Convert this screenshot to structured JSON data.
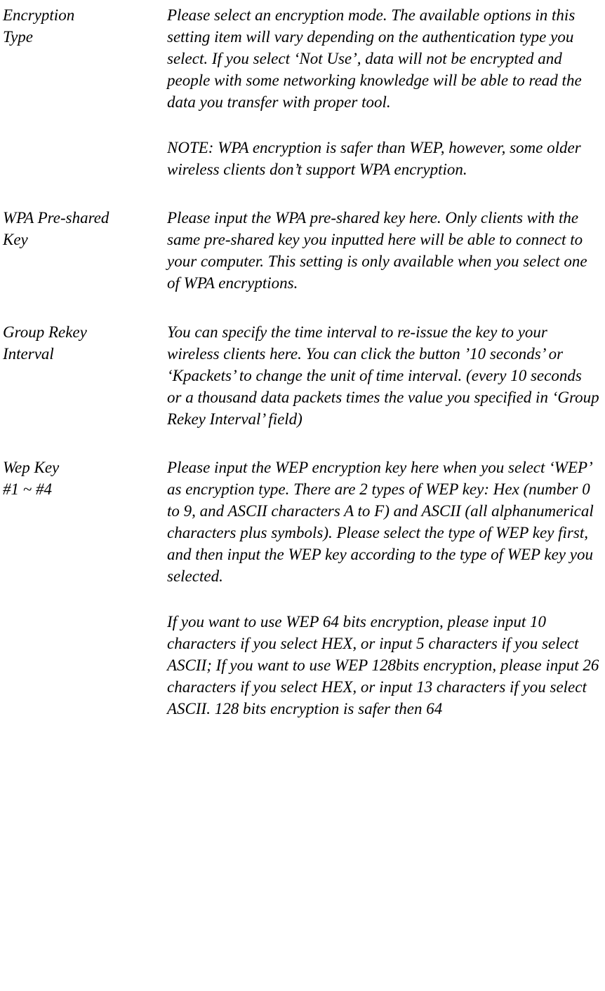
{
  "rows": [
    {
      "label_lines": [
        "Encryption",
        "Type"
      ],
      "paragraphs": [
        "Please select an encryption mode. The available options in this setting item will vary depending on the authentication type you select. If you select ‘Not Use’, data will not be encrypted and people with some networking knowledge will be able to read the data you transfer with proper tool.",
        "NOTE: WPA encryption is safer than WEP, however, some older wireless clients don’t support WPA encryption."
      ]
    },
    {
      "label_lines": [
        "WPA Pre-shared",
        "Key"
      ],
      "paragraphs": [
        "Please input the WPA pre-shared key here. Only clients with the same pre-shared key you inputted here will be able to connect to your computer. This setting is only available when you select one of WPA encryptions."
      ]
    },
    {
      "label_lines": [
        "Group Rekey",
        "Interval"
      ],
      "paragraphs": [
        "You can specify the time interval to re-issue the key to your wireless clients here. You can click the button ’10 seconds’ or ‘Kpackets’ to change the unit of time interval. (every 10 seconds or a thousand data packets times the value you specified in ‘Group Rekey Interval’ field)"
      ]
    },
    {
      "label_lines": [
        "Wep Key",
        "#1 ~ #4"
      ],
      "paragraphs": [
        "Please input the WEP encryption key here when you select ‘WEP’ as encryption type. There are 2 types of WEP key: Hex (number 0 to 9, and ASCII characters A to F) and ASCII (all alphanumerical characters plus symbols). Please select the type of WEP key first, and then input the WEP key according to the type of WEP key you selected.",
        "If you want to use WEP 64 bits encryption, please input 10 characters if you select HEX, or input 5 characters if you select ASCII; If you want to use WEP 128bits encryption, please input 26 characters if you select HEX, or input 13 characters if you select ASCII. 128 bits encryption is safer then 64"
      ]
    }
  ]
}
